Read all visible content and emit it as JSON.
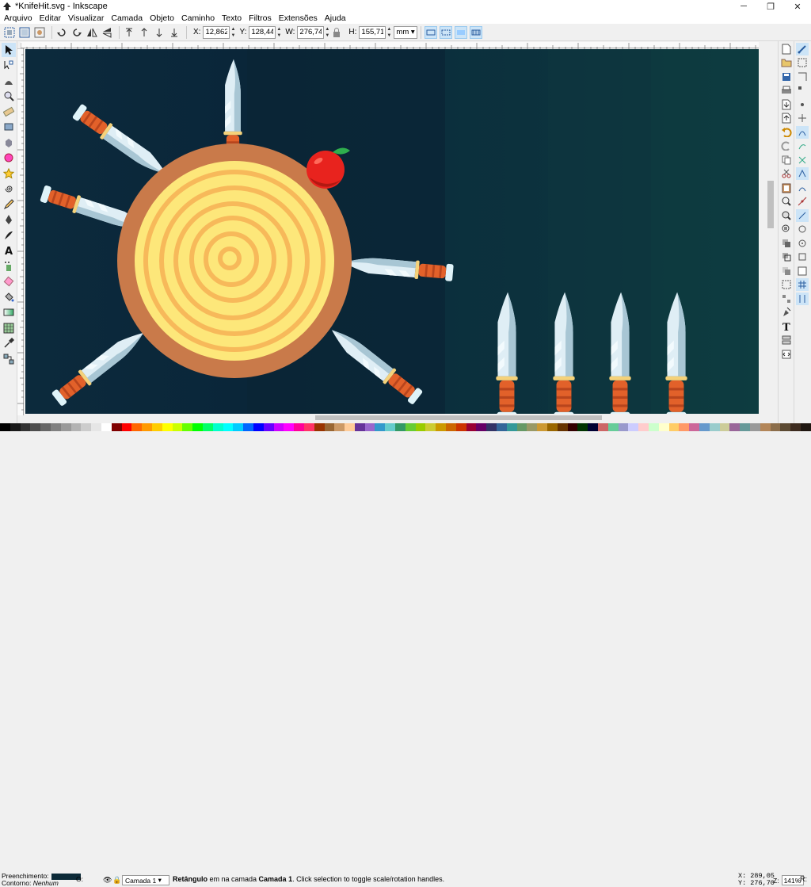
{
  "window": {
    "title": "*KnifeHit.svg - Inkscape",
    "minimize": "─",
    "maximize": "❐",
    "close": "✕"
  },
  "menu": [
    "Arquivo",
    "Editar",
    "Visualizar",
    "Camada",
    "Objeto",
    "Caminho",
    "Texto",
    "Filtros",
    "Extensões",
    "Ajuda"
  ],
  "controls": {
    "x_label": "X:",
    "x_value": "12,862",
    "y_label": "Y:",
    "y_value": "128,443",
    "w_label": "W:",
    "w_value": "276,741",
    "h_label": "H:",
    "h_value": "155,713",
    "unit": "mm",
    "lock_icon": "lock-icon"
  },
  "status": {
    "fill_label": "Preenchimento:",
    "stroke_label": "Contorno:",
    "stroke_value": "Nenhum",
    "opacity_label": "O:",
    "fill_color": "#0c2a38",
    "layer": "Camada 1",
    "message_bold": "Retângulo",
    "message_mid": " em na camada ",
    "message_layer": "Camada 1",
    "message_end": ". Click selection to toggle scale/rotation handles.",
    "cursor_x": "X: 289,05",
    "cursor_y": "Y: 276,70",
    "zoom_label": "Z:",
    "zoom_value": "141%",
    "rotation_label": "R:"
  },
  "colors": {
    "bg_dark": "#0c2a38",
    "wood_outer": "#c97a4a",
    "wood_inner": "#fde77a",
    "wood_rings": "#f7b95a",
    "handle": "#e2612a",
    "handle_stripe": "#b8451d",
    "blade": "#dfeef5",
    "blade_shade": "#8fb3c3",
    "guard": "#f5d27a",
    "apple": "#e8231e"
  },
  "palette": [
    "#000000",
    "#1a1a1a",
    "#333333",
    "#4d4d4d",
    "#666666",
    "#808080",
    "#999999",
    "#b3b3b3",
    "#cccccc",
    "#e6e6e6",
    "#ffffff",
    "#800000",
    "#ff0000",
    "#ff6600",
    "#ff9900",
    "#ffcc00",
    "#ffff00",
    "#ccff00",
    "#66ff00",
    "#00ff00",
    "#00ff66",
    "#00ffcc",
    "#00ffff",
    "#00ccff",
    "#0066ff",
    "#0000ff",
    "#6600ff",
    "#cc00ff",
    "#ff00ff",
    "#ff0099",
    "#ff3366",
    "#993300",
    "#996633",
    "#cc9966",
    "#ffcc99",
    "#663399",
    "#9966cc",
    "#3399cc",
    "#66cccc",
    "#339966",
    "#66cc33",
    "#99cc00",
    "#cccc33",
    "#cc9900",
    "#cc6600",
    "#cc3300",
    "#990033",
    "#660066",
    "#333366",
    "#336699",
    "#339999",
    "#669966",
    "#999966",
    "#cc9933",
    "#996600",
    "#663300",
    "#330000",
    "#003300",
    "#000033",
    "#cc6666",
    "#66cc99",
    "#9999cc",
    "#ccccff",
    "#ffcccc",
    "#ccffcc",
    "#ffffcc",
    "#ffcc66",
    "#ff9966",
    "#cc6699",
    "#6699cc",
    "#99cccc",
    "#cccc99",
    "#996699",
    "#669999",
    "#999999",
    "#b38659",
    "#8c6e4b",
    "#5c4a33",
    "#3d2b1f",
    "#1f1610"
  ]
}
